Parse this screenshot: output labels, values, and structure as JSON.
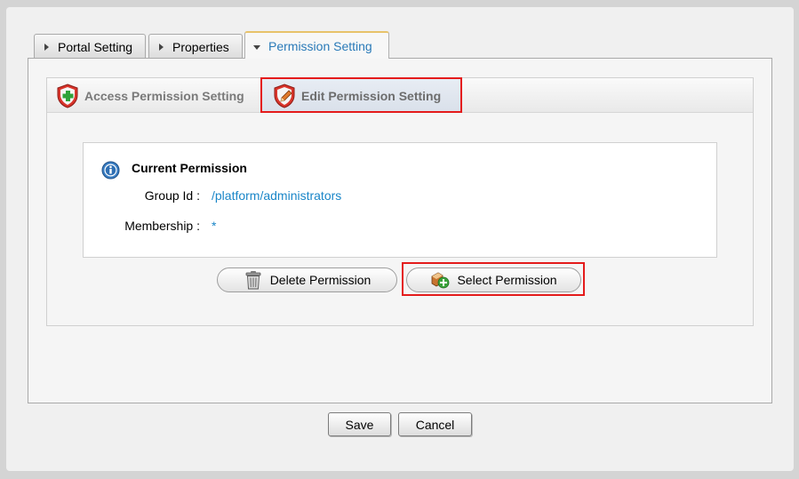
{
  "top_tabs": [
    {
      "label": "Portal Setting",
      "icon": "triangle-right-icon"
    },
    {
      "label": "Properties",
      "icon": "triangle-right-icon"
    },
    {
      "label": "Permission Setting",
      "icon": "triangle-down-icon",
      "active": true
    }
  ],
  "sub_tabs": [
    {
      "label": "Access Permission Setting",
      "icon": "shield-plus-icon"
    },
    {
      "label": "Edit Permission Setting",
      "icon": "shield-edit-icon",
      "active": true
    }
  ],
  "current_permission": {
    "title": "Current Permission",
    "group_label": "Group Id :",
    "group_value": "/platform/administrators",
    "membership_label": "Membership :",
    "membership_value": "*"
  },
  "actions": {
    "delete_label": "Delete Permission",
    "select_label": "Select Permission"
  },
  "footer": {
    "save_label": "Save",
    "cancel_label": "Cancel"
  },
  "colors": {
    "accent_link": "#1a86c8",
    "highlight": "#e41b1b",
    "active_tab_border": "#e8c36a"
  }
}
